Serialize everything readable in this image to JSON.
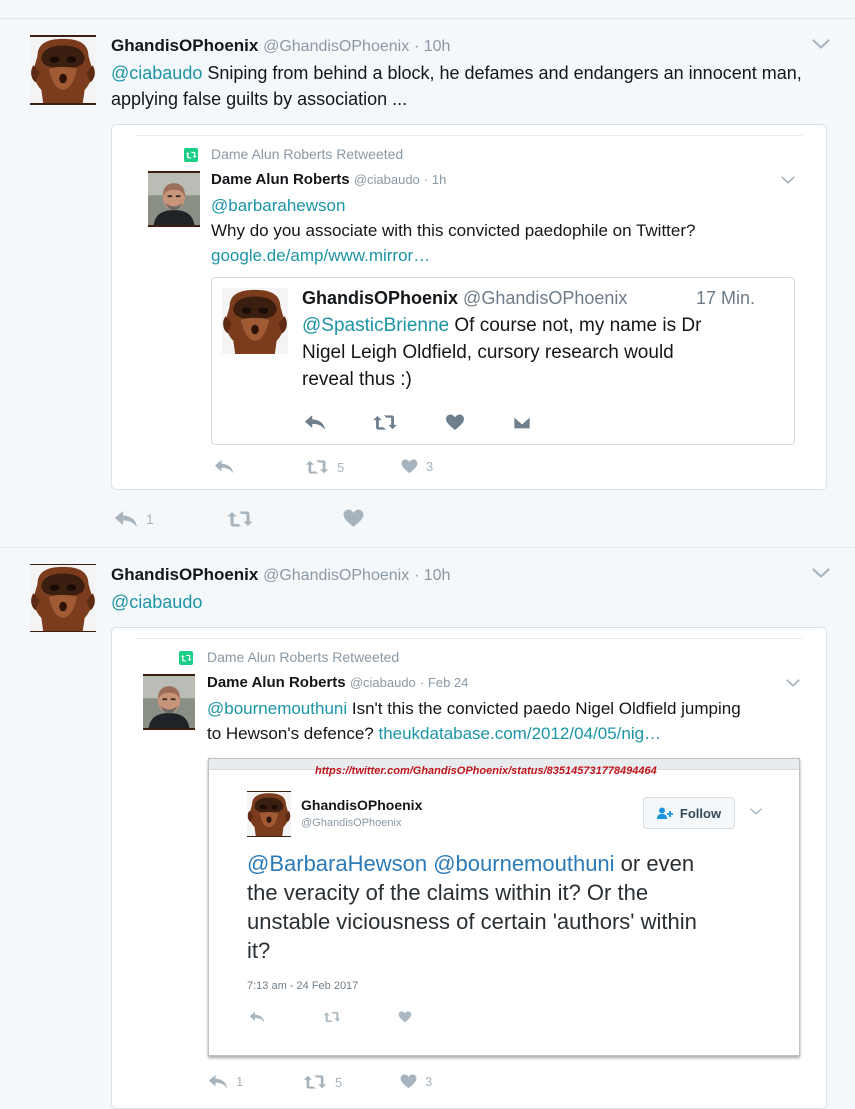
{
  "tweets": [
    {
      "author_name": "GhandisOPhoenix",
      "author_handle": "@GhandisOPhoenix",
      "time": "· 10h",
      "mention": "@ciabaudo",
      "text": " Sniping from behind a block, he defames and endangers an innocent man, applying false guilts by association ...",
      "quoted": {
        "retweeted_by": "Dame Alun Roberts Retweeted",
        "author_name": "Dame Alun Roberts",
        "author_handle": "@ciabaudo",
        "time": "· 1h",
        "mention": "@barbarahewson",
        "text": "Why do you associate with this convicted paedophile on Twitter?",
        "link": "google.de/amp/www.mirror…",
        "embedded": {
          "author_name": "GhandisOPhoenix",
          "author_handle": "@GhandisOPhoenix",
          "time": "17 Min.",
          "mention": "@SpasticBrienne",
          "text_line1": " Of course not, my name is Dr",
          "text_line2": "Nigel Leigh Oldfield, cursory research would",
          "text_line3": "reveal thus :)"
        },
        "retweet_count": "5",
        "like_count": "3"
      },
      "reply_count": "1"
    },
    {
      "author_name": "GhandisOPhoenix",
      "author_handle": "@GhandisOPhoenix",
      "time": "· 10h",
      "mention": "@ciabaudo",
      "quoted": {
        "retweeted_by": "Dame Alun Roberts Retweeted",
        "author_name": "Dame Alun Roberts",
        "author_handle": "@ciabaudo",
        "time": "· Feb 24",
        "mention": "@bournemouthuni",
        "text": " Isn't this the convicted paedo Nigel Oldfield jumping",
        "text_line2": "to Hewson's defence? ",
        "link": "theukdatabase.com/2012/04/05/nig…",
        "screenshot": {
          "url": "https://twitter.com/GhandisOPhoenix/status/835145731778494464",
          "author_name": "GhandisOPhoenix",
          "author_handle": "@GhandisOPhoenix",
          "follow_label": "Follow",
          "mention1": "@BarbaraHewson",
          "mention2": "@bournemouthuni",
          "text_line1": " or even",
          "text_line2": "the veracity of the claims within it? Or the",
          "text_line3": "unstable viciousness of certain 'authors' within",
          "text_line4": "it?",
          "timestamp": "7:13 am - 24 Feb 2017"
        },
        "reply_count": "1",
        "retweet_count": "5",
        "like_count": "3"
      }
    }
  ],
  "icons": [
    "reply-icon",
    "retweet-icon",
    "like-icon",
    "dm-icon",
    "chevron-down-icon",
    "retweet-badge-icon",
    "follow-person-icon"
  ],
  "colors": {
    "link": "#1b95a6",
    "retweet_green": "#19cf86",
    "url_red": "#c0141b",
    "icon_grey": "#a7b3bd"
  }
}
